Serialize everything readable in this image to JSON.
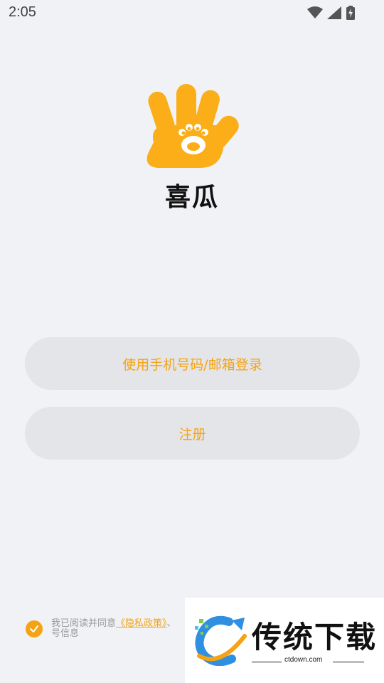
{
  "status_bar": {
    "time": "2:05"
  },
  "app": {
    "name": "喜瓜"
  },
  "buttons": {
    "login": "使用手机号码/邮箱登录",
    "register": "注册"
  },
  "agreement": {
    "prefix": "我已阅读并同意",
    "privacy_link": "《隐私政策》",
    "separator": "、",
    "line2": "号信息"
  },
  "watermark": {
    "title": "传统下载",
    "url": "ctdown.com"
  },
  "colors": {
    "accent": "#f5a313",
    "background": "#f1f2f6",
    "button_bg": "#e4e5e8"
  }
}
